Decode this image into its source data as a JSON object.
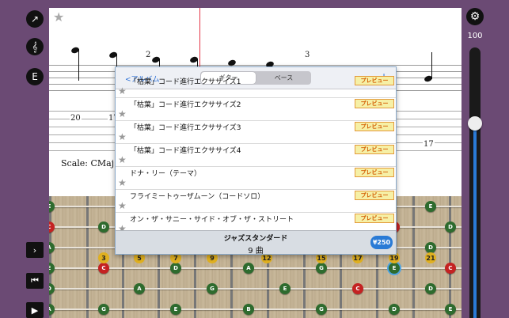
{
  "left_rail": {
    "flip_label": "↗",
    "clef_label": "𝄞",
    "key_label": "E",
    "next_label": "›",
    "restart_label": "⏮",
    "play_label": "▶"
  },
  "volume": {
    "label": "100",
    "level": 0.72,
    "accent": "#2a7bd6"
  },
  "score": {
    "fret_numbers": [
      "20",
      "17",
      "2",
      "3",
      "17"
    ],
    "scale_text": "Scale: CMaj Pen"
  },
  "fretboard": {
    "notes": [
      "E",
      "C",
      "D",
      "A",
      "G",
      "E",
      "C",
      "D",
      "A",
      "G",
      "E",
      "C",
      "D",
      "A",
      "G",
      "E",
      "B",
      "G",
      "D"
    ],
    "fret_markers": [
      "3",
      "5",
      "7",
      "9",
      "12",
      "15",
      "17",
      "19",
      "21"
    ]
  },
  "popover": {
    "back_label": "<アルバム",
    "tabs": [
      {
        "label": "ギター",
        "active": true
      },
      {
        "label": "ベース",
        "active": false
      }
    ],
    "rows": [
      {
        "title": "「枯葉」コード進行エクササイズ1",
        "badge": "プレビュー"
      },
      {
        "title": "「枯葉」コード進行エクササイズ2",
        "badge": "プレビュー"
      },
      {
        "title": "「枯葉」コード進行エクササイズ3",
        "badge": "プレビュー"
      },
      {
        "title": "「枯葉」コード進行エクササイズ4",
        "badge": "プレビュー"
      },
      {
        "title": "ドナ・リー（テーマ）",
        "badge": "プレビュー"
      },
      {
        "title": "フライミートゥーザムーン（コードソロ）",
        "badge": "プレビュー"
      },
      {
        "title": "オン・ザ・サニー・サイド・オブ・ザ・ストリート",
        "badge": "プレビュー"
      }
    ],
    "footer": {
      "title": "ジャズスタンダード",
      "count": "9 曲",
      "price": "¥250"
    }
  }
}
